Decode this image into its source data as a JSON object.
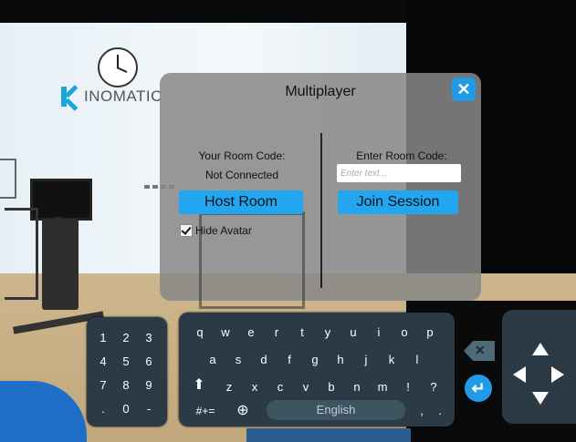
{
  "scene": {
    "logo_text": "INOMATIC"
  },
  "panel": {
    "title": "Multiplayer",
    "close_glyph": "✕",
    "your_room_code_label": "Your Room Code:",
    "room_code_value": "Not Connected",
    "host_button": "Host Room",
    "hide_avatar_label": "Hide Avatar",
    "hide_avatar_checked": true,
    "enter_room_code_label": "Enter Room Code:",
    "room_code_input_value": "",
    "room_code_input_placeholder": "Enter text...",
    "join_button": "Join Session"
  },
  "numpad": {
    "keys": [
      "1",
      "2",
      "3",
      "4",
      "5",
      "6",
      "7",
      "8",
      "9",
      ".",
      "0",
      "-"
    ]
  },
  "keyboard": {
    "row1": [
      "q",
      "w",
      "e",
      "r",
      "t",
      "y",
      "u",
      "i",
      "o",
      "p"
    ],
    "row2": [
      "a",
      "s",
      "d",
      "f",
      "g",
      "h",
      "j",
      "k",
      "l"
    ],
    "row3": [
      "z",
      "x",
      "c",
      "v",
      "b",
      "n",
      "m",
      "!",
      "?"
    ],
    "shift_glyph": "⬆",
    "symbols_key": "#+=",
    "globe_glyph": "⊕",
    "language": "English",
    "comma": ",",
    "period": "."
  },
  "side_controls": {
    "backspace_glyph": "✕",
    "enter_glyph": "↵",
    "dpad": [
      "up",
      "down",
      "left",
      "right"
    ]
  },
  "colors": {
    "accent": "#23a6f0",
    "panel": "#878787",
    "keyboard": "#2c3a45"
  },
  "icons": [
    "clock-icon",
    "logo-icon",
    "close-icon",
    "checkbox-icon",
    "shift-icon",
    "globe-icon",
    "backspace-icon",
    "enter-icon",
    "arrow-up-icon",
    "arrow-down-icon",
    "arrow-left-icon",
    "arrow-right-icon"
  ]
}
